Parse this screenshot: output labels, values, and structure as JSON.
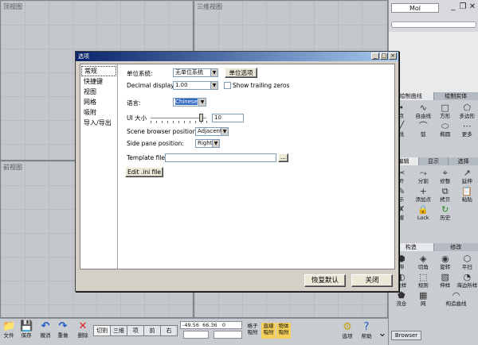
{
  "viewports": {
    "top_title": "顶视图",
    "persp_title": "三维视图",
    "front_title": "前视图"
  },
  "right_panel": {
    "mol_label": "Mol",
    "win_min": "_",
    "win_restore": "❐",
    "win_close": "✕",
    "draw_tabs": [
      "绘制曲线",
      "绘制实体"
    ],
    "draw_tools": [
      {
        "label": "点",
        "icon": "•"
      },
      {
        "label": "自由线",
        "icon": "∿"
      },
      {
        "label": "方形",
        "icon": "□"
      },
      {
        "label": "多边形",
        "icon": "⬠"
      },
      {
        "label": "线",
        "icon": "╱"
      },
      {
        "label": "弧",
        "icon": "⌒"
      },
      {
        "label": "椭圆",
        "icon": "⬭"
      },
      {
        "label": "更多",
        "icon": "⋯"
      }
    ],
    "edit_tabs": [
      "编辑",
      "显示",
      "选择"
    ],
    "edit_tools": [
      {
        "label": "开",
        "icon": "✂"
      },
      {
        "label": "分割",
        "icon": "⤳"
      },
      {
        "label": "修整",
        "icon": "⌖"
      },
      {
        "label": "延伸",
        "icon": "↗"
      },
      {
        "label": "示",
        "icon": "✎"
      },
      {
        "label": "添加点",
        "icon": "+"
      },
      {
        "label": "拷贝",
        "icon": "⧉"
      },
      {
        "label": "粘贴",
        "icon": "📋"
      },
      {
        "label": "撤",
        "icon": "✗"
      },
      {
        "label": "Lock",
        "icon": "🔒"
      },
      {
        "label": "历史",
        "icon": "↻"
      }
    ],
    "construct_tabs": [
      "构造",
      "修改"
    ],
    "construct_tools": [
      {
        "label": "伸",
        "icon": "⬢"
      },
      {
        "label": "切角",
        "icon": "◈"
      },
      {
        "label": "旋转",
        "icon": "◉"
      },
      {
        "label": "平扫",
        "icon": "⬡"
      },
      {
        "label": "放样",
        "icon": "◐"
      },
      {
        "label": "规则",
        "icon": "⬚"
      },
      {
        "label": "伸样",
        "icon": "▧"
      },
      {
        "label": "海边所样",
        "icon": "◔"
      },
      {
        "label": "流合",
        "icon": "⬟"
      },
      {
        "label": "网",
        "icon": "▦"
      },
      {
        "label": "构造曲线",
        "icon": "◠"
      }
    ],
    "browser_label": "Browser"
  },
  "bottom_bar": {
    "tools": [
      {
        "label": "文件",
        "icon": "📁"
      },
      {
        "label": "保存",
        "icon": "💾"
      },
      {
        "label": "撤消",
        "icon": "↶"
      },
      {
        "label": "重做",
        "icon": "↷"
      },
      {
        "label": "删除",
        "icon": "✕"
      }
    ],
    "view_tabs": [
      "切割",
      "三维",
      "项",
      "前",
      "右"
    ],
    "coords": "-49.56  66.36   0",
    "snap_grid": "格子吸附",
    "snap_line": "直線吸附",
    "snap_obj": "物体吸附",
    "select_label": "选项",
    "help_label": "帮助"
  },
  "dialog": {
    "title": "选项",
    "nav_items": [
      "常规",
      "快捷键",
      "视图",
      "网格",
      "吸附",
      "导入/导出"
    ],
    "selected_nav": "常规",
    "unit_system_label": "单位系统:",
    "unit_system_value": "无单位系统",
    "unit_options_button": "单位选项",
    "decimal_display_label": "Decimal display",
    "decimal_display_value": "1.00",
    "show_trailing_zeros_label": "Show trailing zeros",
    "language_label": "语言:",
    "language_value": "Chinese",
    "ui_size_label": "UI 大小",
    "ui_size_value": "10",
    "scene_browser_label": "Scene browser position:",
    "scene_browser_value": "Adjacent",
    "side_pane_label": "Side pane position:",
    "side_pane_value": "Right",
    "template_file_label": "Template file:",
    "template_file_value": "",
    "browse_button": "...",
    "edit_ini_button": "Edit .ini file",
    "restore_defaults_button": "恢复默认",
    "close_button": "关闭"
  }
}
